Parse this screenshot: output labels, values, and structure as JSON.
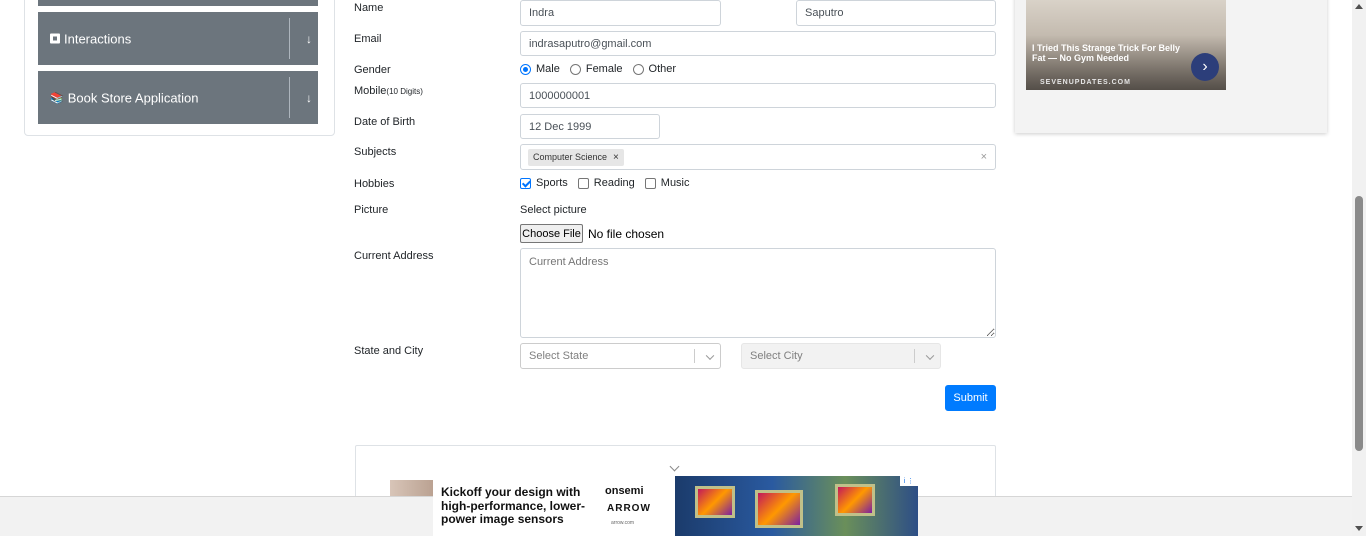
{
  "sidebar": {
    "items": [
      {
        "label": "Interactions",
        "icon": "interactions-icon"
      },
      {
        "label": "Book Store Application",
        "icon": "books-icon"
      }
    ],
    "download_icon": "↓"
  },
  "form": {
    "name_label": "Name",
    "first_name": "Indra",
    "last_name": "Saputro",
    "email_label": "Email",
    "email": "indrasaputro@gmail.com",
    "gender_label": "Gender",
    "gender_options": [
      "Male",
      "Female",
      "Other"
    ],
    "gender_selected": "Male",
    "mobile_label": "Mobile",
    "mobile_hint": "(10 Digits)",
    "mobile": "1000000001",
    "dob_label": "Date of Birth",
    "dob": "12 Dec 1999",
    "subjects_label": "Subjects",
    "subject_chip": "Computer Science",
    "chip_remove": "×",
    "clear": "×",
    "hobbies_label": "Hobbies",
    "hobbies": [
      "Sports",
      "Reading",
      "Music"
    ],
    "hobbies_checked": [
      "Sports"
    ],
    "picture_label": "Picture",
    "select_picture": "Select picture",
    "choose_file": "Choose File",
    "no_file": "No file chosen",
    "address_label": "Current Address",
    "address_placeholder": "Current Address",
    "state_city_label": "State and City",
    "state_placeholder": "Select State",
    "city_placeholder": "Select City",
    "submit": "Submit"
  },
  "ad_right": {
    "headline": "I Tried This Strange Trick For Belly Fat — No Gym Needed",
    "source": "SEVENUPDATES.COM",
    "arrow": "›"
  },
  "banner": {
    "headline": "Kickoff your design with high-performance, lower-power image sensors",
    "brand1": "onsemi",
    "brand2": "ARROW",
    "brand3": "arrow.com",
    "adchoice": "i ⋮"
  }
}
